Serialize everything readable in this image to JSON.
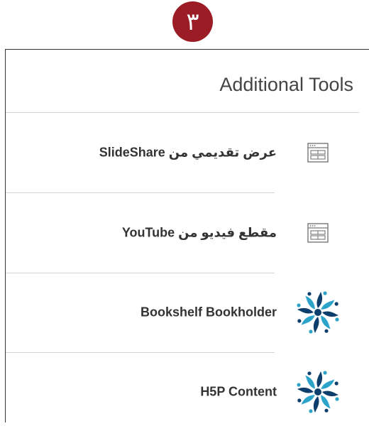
{
  "step": {
    "number": "٣"
  },
  "tools": {
    "title": "Additional Tools",
    "items": [
      {
        "label": "عرض تقديمي من SlideShare",
        "icon": "web-page-icon"
      },
      {
        "label": "مقطع فيديو من YouTube",
        "icon": "web-page-icon"
      },
      {
        "label": "Bookshelf Bookholder",
        "icon": "pinwheel-icon"
      },
      {
        "label": "H5P Content",
        "icon": "pinwheel-icon"
      }
    ]
  },
  "colors": {
    "badge": "#9b1c24",
    "pinwheel_dark": "#0e3e6c",
    "pinwheel_light": "#2da3c9"
  }
}
